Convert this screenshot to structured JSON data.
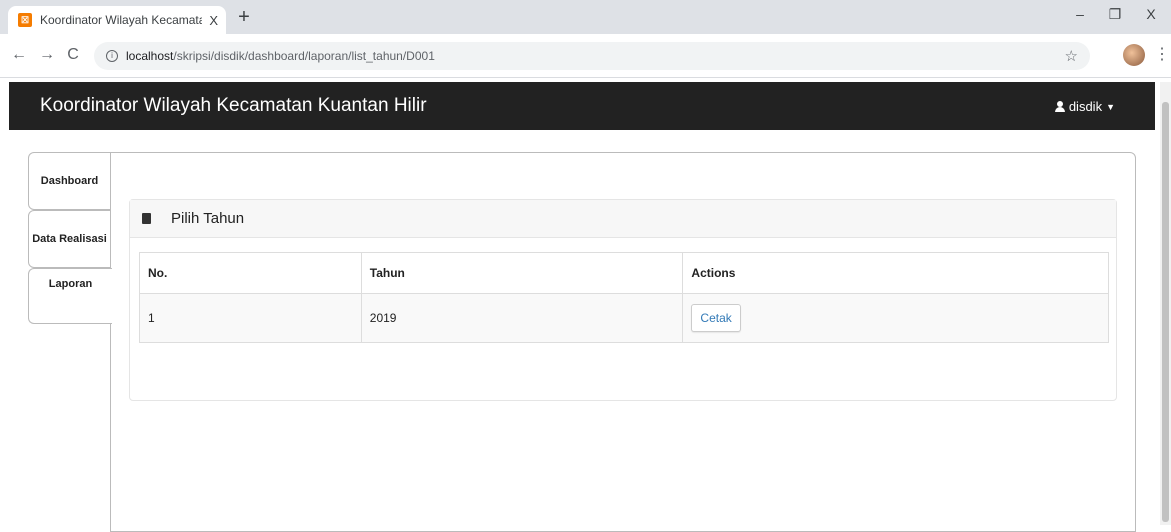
{
  "browser": {
    "tab_title": "Koordinator Wilayah Kecamatan Kuantan Hilir",
    "tab_close": "X",
    "new_tab": "+",
    "url_host": "localhost",
    "url_path": "/skripsi/disdik/dashboard/laporan/list_tahun/D001",
    "win_minimize": "–",
    "win_maximize": "❐",
    "win_close": "X"
  },
  "navbar": {
    "brand": "Koordinator Wilayah Kecamatan Kuantan Hilir",
    "user": "disdik"
  },
  "sidebar": {
    "items": [
      {
        "label": "Dashboard"
      },
      {
        "label": "Data Realisasi"
      },
      {
        "label": "Laporan"
      }
    ]
  },
  "widget": {
    "title": "Pilih Tahun"
  },
  "table": {
    "headers": [
      "No.",
      "Tahun",
      "Actions"
    ],
    "rows": [
      {
        "no": "1",
        "tahun": "2019",
        "action": "Cetak"
      }
    ]
  }
}
